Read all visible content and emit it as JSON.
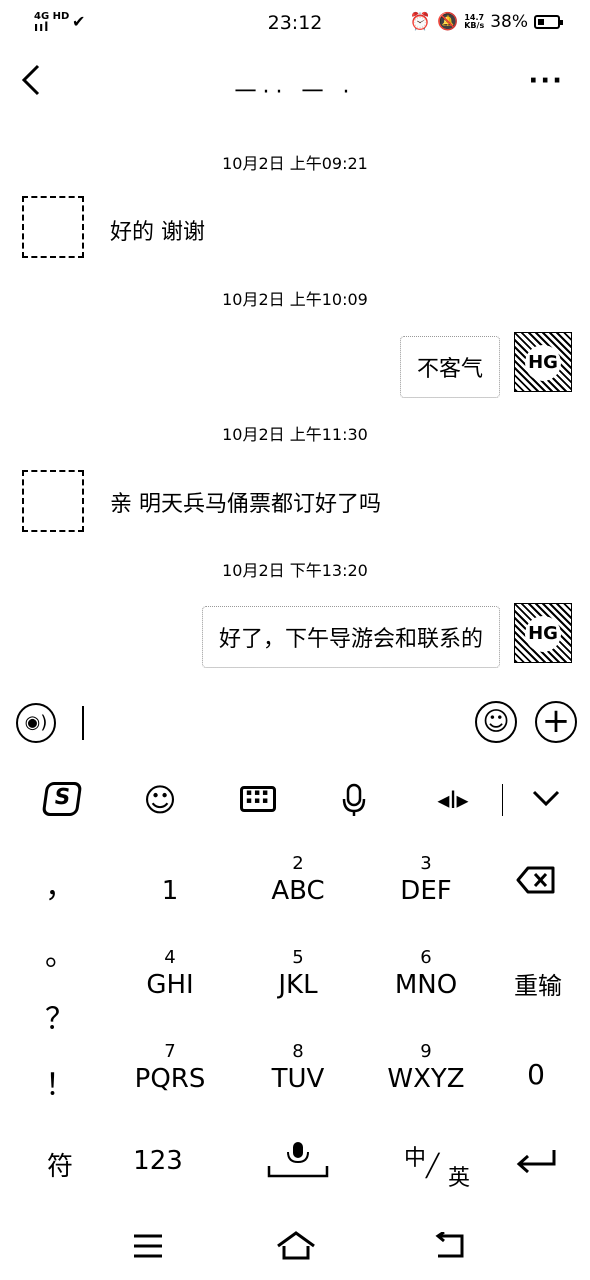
{
  "status_bar": {
    "network": "4G HD",
    "signal": "ııl",
    "time": "23:12",
    "speed_value": "14.7",
    "speed_unit": "KB/s",
    "battery": "38%"
  },
  "header": {
    "title": "一·· 一 ·",
    "more": "···"
  },
  "messages": [
    {
      "time": "10月2日 上午09:21",
      "side": "left",
      "text": "好的 谢谢"
    },
    {
      "time": "10月2日 上午10:09",
      "side": "right",
      "text": "不客气"
    },
    {
      "time": "10月2日 上午11:30",
      "side": "left",
      "text": "亲 明天兵马俑票都订好了吗"
    },
    {
      "time": "10月2日 下午13:20",
      "side": "right",
      "text": "好了，下午导游会和联系的"
    }
  ],
  "avatar_right_text": "HG",
  "input": {
    "value": "",
    "voice_icon": "voice-icon",
    "emoji_icon": "emoji-icon",
    "plus_icon": "plus-icon"
  },
  "ime_toolbar": {
    "logo": "S",
    "icons": [
      "sogou-logo-icon",
      "emoji-icon",
      "keyboard-icon",
      "microphone-icon",
      "cursor-move-icon",
      "chevron-down-icon"
    ]
  },
  "keyboard": {
    "punctuation": [
      "，",
      "。",
      "？",
      "！"
    ],
    "keys": [
      {
        "num": "",
        "label": "1"
      },
      {
        "num": "2",
        "label": "ABC"
      },
      {
        "num": "3",
        "label": "DEF"
      },
      {
        "num": "4",
        "label": "GHI"
      },
      {
        "num": "5",
        "label": "JKL"
      },
      {
        "num": "6",
        "label": "MNO"
      },
      {
        "num": "7",
        "label": "PQRS"
      },
      {
        "num": "8",
        "label": "TUV"
      },
      {
        "num": "9",
        "label": "WXYZ"
      }
    ],
    "delete_icon": "backspace-icon",
    "reenter": "重输",
    "zero": "0",
    "symbol": "符",
    "num_mode": "123",
    "lang_zh": "中",
    "lang_en": "英",
    "enter_icon": "enter-icon"
  },
  "nav_bar": {
    "menu_icon": "menu-icon",
    "home_icon": "home-icon",
    "back_icon": "back-icon"
  }
}
